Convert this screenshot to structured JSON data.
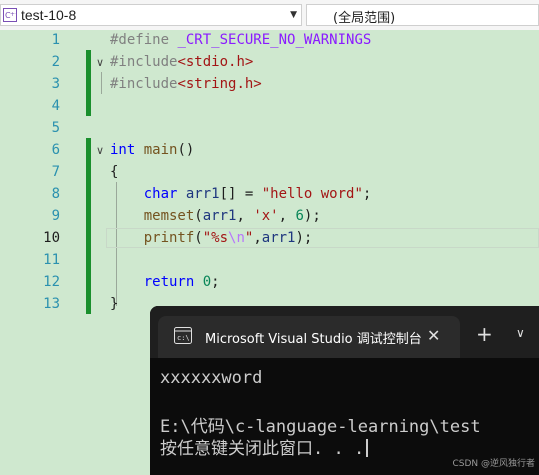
{
  "toolbar": {
    "file_combo_value": "test-10-8",
    "scope_combo_value": "(全局范围)"
  },
  "editor": {
    "current_line": 10,
    "lines": [
      {
        "num": "1"
      },
      {
        "num": "2"
      },
      {
        "num": "3"
      },
      {
        "num": "4"
      },
      {
        "num": "5"
      },
      {
        "num": "6"
      },
      {
        "num": "7"
      },
      {
        "num": "8"
      },
      {
        "num": "9"
      },
      {
        "num": "10"
      },
      {
        "num": "11"
      },
      {
        "num": "12"
      },
      {
        "num": "13"
      }
    ],
    "tokens": {
      "l1_directive": "#define",
      "l1_macro": "_CRT_SECURE_NO_WARNINGS",
      "l2_directive": "#include",
      "l2_header": "<stdio.h>",
      "l3_directive": "#include",
      "l3_header": "<string.h>",
      "l6_type": "int",
      "l6_func": "main",
      "l6_parens": "()",
      "l7_brace": "{",
      "l8_type": "char",
      "l8_var": "arr1",
      "l8_rest": "[] = ",
      "l8_str": "\"hello word\"",
      "l8_semi": ";",
      "l9_func": "memset",
      "l9_open": "(",
      "l9_var": "arr1",
      "l9_comma": ", ",
      "l9_char": "'x'",
      "l9_comma2": ", ",
      "l9_num": "6",
      "l9_close": ");",
      "l10_func": "printf",
      "l10_open": "(",
      "l10_str_a": "\"%s",
      "l10_esc": "\\n",
      "l10_str_b": "\"",
      "l10_comma": ",",
      "l10_var": "arr1",
      "l10_close": ");",
      "l12_kw": "return",
      "l12_num": "0",
      "l12_semi": ";",
      "l13_brace": "}"
    }
  },
  "console": {
    "tab_title": "Microsoft Visual Studio 调试控制台",
    "output_line1": "xxxxxxword",
    "output_line2": "E:\\代码\\c-language-learning\\test",
    "output_line3": "按任意键关闭此窗口. . ."
  },
  "watermark": "CSDN @逆风独行者",
  "colors": {
    "editor_bg": "#cfe8cf",
    "gutter_bar": "#1a8f2d",
    "keyword": "#0000ff",
    "string": "#a31515",
    "console_bg": "#0c0c0c"
  }
}
